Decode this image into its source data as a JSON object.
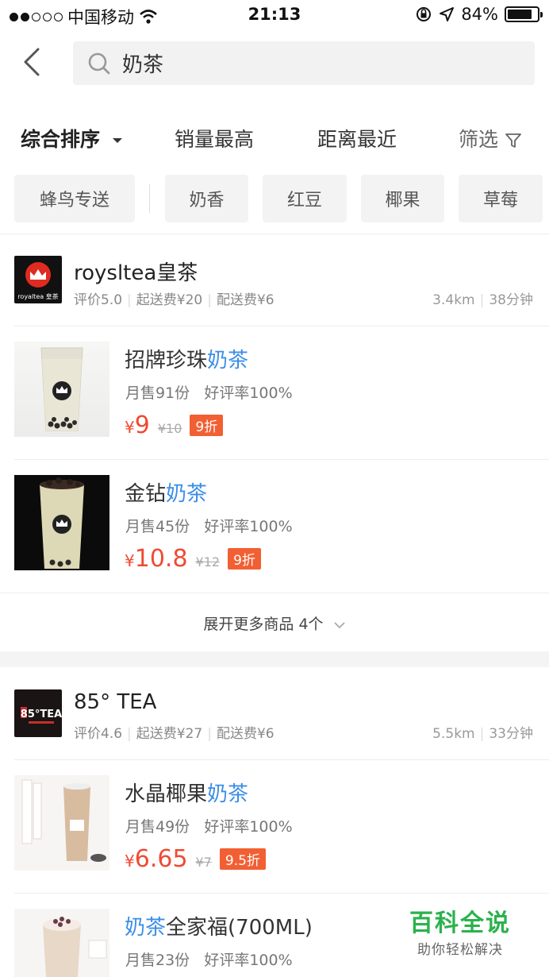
{
  "status_bar": {
    "carrier": "中国移动",
    "time": "21:13",
    "battery": "84%"
  },
  "search": {
    "query": "奶茶"
  },
  "sort": {
    "comprehensive": "综合排序",
    "sales": "销量最高",
    "distance": "距离最近",
    "filter": "筛选"
  },
  "chips": [
    "蜂鸟专送",
    "奶香",
    "红豆",
    "椰果",
    "草莓"
  ],
  "shops": [
    {
      "logo_text": "royaltea 皇茶",
      "name": "roysltea皇茶",
      "rating": "评价5.0",
      "min_order": "起送费¥20",
      "delivery_fee": "配送费¥6",
      "distance": "3.4km",
      "time": "38分钟",
      "products": [
        {
          "name_prefix": "招牌珍珠",
          "name_highlight": "奶茶",
          "name_suffix": "",
          "sales": "月售91份",
          "rating": "好评率100%",
          "currency": "¥",
          "price": "9",
          "old_price": "¥10",
          "discount": "9折"
        },
        {
          "name_prefix": "金钻",
          "name_highlight": "奶茶",
          "name_suffix": "",
          "sales": "月售45份",
          "rating": "好评率100%",
          "currency": "¥",
          "price": "10.8",
          "old_price": "¥12",
          "discount": "9折"
        }
      ],
      "more": "展开更多商品 4个"
    },
    {
      "logo_text": "85°TEA",
      "name": "85° TEA",
      "rating": "评价4.6",
      "min_order": "起送费¥27",
      "delivery_fee": "配送费¥6",
      "distance": "5.5km",
      "time": "33分钟",
      "products": [
        {
          "name_prefix": "水晶椰果",
          "name_highlight": "奶茶",
          "name_suffix": "",
          "sales": "月售49份",
          "rating": "好评率100%",
          "currency": "¥",
          "price": "6.65",
          "old_price": "¥7",
          "discount": "9.5折"
        },
        {
          "name_prefix": "",
          "name_highlight": "奶茶",
          "name_suffix": "全家福(700ML)",
          "sales": "月售23份",
          "rating": "好评率100%"
        }
      ]
    }
  ],
  "watermark": {
    "title": "百科全说",
    "subtitle": "助你轻松解决"
  }
}
